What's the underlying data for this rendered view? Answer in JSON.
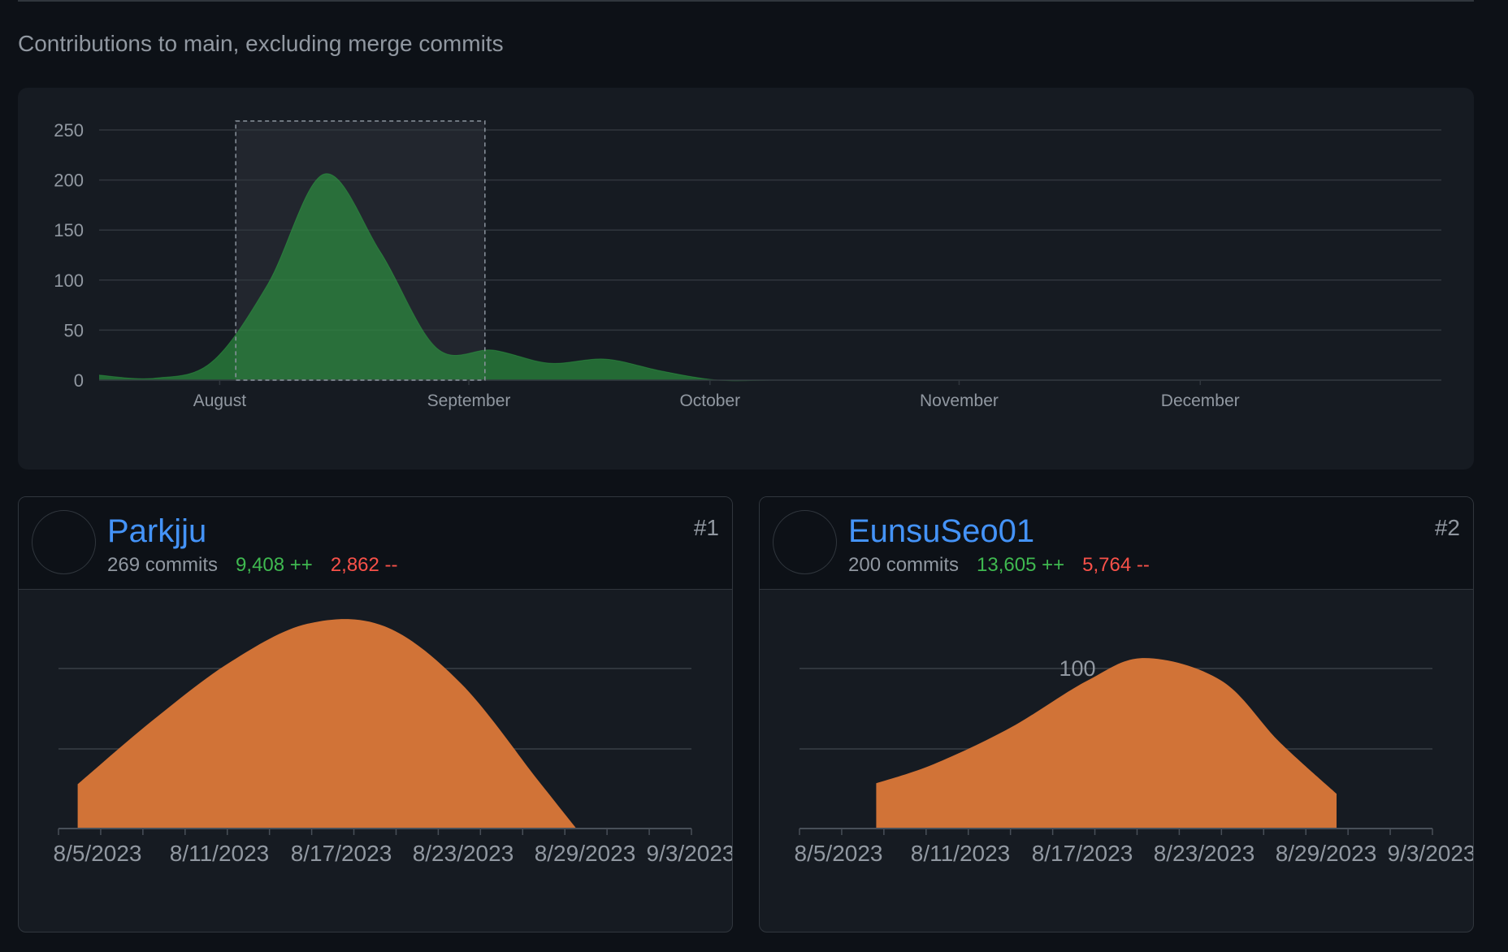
{
  "caption": "Contributions to main, excluding merge commits",
  "colors": {
    "background": "#0d1117",
    "panel": "#161b22",
    "border": "#30363d",
    "grid": "#30363d",
    "text_muted": "#9198a1",
    "link": "#4493f8",
    "additions": "#3fb950",
    "deletions": "#f85149",
    "main_area": "#2ea043",
    "contributor_area": "#d17337",
    "selection": "#30363d"
  },
  "chart_data": [
    {
      "type": "area",
      "title": "",
      "xlabel": "",
      "ylabel": "",
      "grid": true,
      "ylim": [
        0,
        250
      ],
      "y_ticks": [
        "0",
        "50",
        "100",
        "150",
        "200",
        "250"
      ],
      "x_range": [
        "2023-07-17",
        "2023-12-31"
      ],
      "x_ticks": [
        {
          "label": "August",
          "date": "2023-08-01"
        },
        {
          "label": "September",
          "date": "2023-09-01"
        },
        {
          "label": "October",
          "date": "2023-10-01"
        },
        {
          "label": "November",
          "date": "2023-11-01"
        },
        {
          "label": "December",
          "date": "2023-12-01"
        }
      ],
      "selection": {
        "start": "2023-08-03",
        "end": "2023-09-03"
      },
      "x": [
        "2023-07-17",
        "2023-07-24",
        "2023-07-31",
        "2023-08-07",
        "2023-08-14",
        "2023-08-21",
        "2023-08-28",
        "2023-09-04",
        "2023-09-11",
        "2023-09-18",
        "2023-09-25",
        "2023-10-02",
        "2023-10-09",
        "2023-10-16",
        "2023-10-23",
        "2023-10-30",
        "2023-11-06",
        "2023-11-13",
        "2023-11-20",
        "2023-11-27",
        "2023-12-04",
        "2023-12-11",
        "2023-12-18",
        "2023-12-25",
        "2023-12-31"
      ],
      "values": [
        5,
        2,
        18,
        96,
        206,
        128,
        32,
        30,
        17,
        21,
        9,
        0,
        0,
        0,
        0,
        0,
        0,
        0,
        0,
        0,
        0,
        0,
        0,
        0,
        0
      ]
    },
    {
      "type": "area",
      "title": "",
      "ylim": [
        0,
        160
      ],
      "grid": true,
      "x_range": [
        "2023-08-02",
        "2023-09-04"
      ],
      "x_ticks": [
        "8/5/2023",
        "8/11/2023",
        "8/17/2023",
        "8/23/2023",
        "8/29/2023",
        "9/3/2023"
      ],
      "x": [
        "2023-08-03",
        "2023-08-07",
        "2023-08-11",
        "2023-08-15",
        "2023-08-19",
        "2023-08-23",
        "2023-08-27",
        "2023-08-29"
      ],
      "values": [
        34,
        84,
        128,
        157,
        155,
        111,
        37,
        0
      ]
    },
    {
      "type": "area",
      "title": "",
      "ylim": [
        0,
        120
      ],
      "y_ticks": [
        "100"
      ],
      "grid": true,
      "x_range": [
        "2023-08-02",
        "2023-09-04"
      ],
      "x_ticks": [
        "8/5/2023",
        "8/11/2023",
        "8/17/2023",
        "8/23/2023",
        "8/29/2023",
        "9/3/2023"
      ],
      "x": [
        "2023-08-06",
        "2023-08-09",
        "2023-08-13",
        "2023-08-17",
        "2023-08-20",
        "2023-08-24",
        "2023-08-27",
        "2023-08-30"
      ],
      "values": [
        26,
        37,
        58,
        85,
        98,
        85,
        50,
        20
      ]
    }
  ],
  "contributors": [
    {
      "rank": "#1",
      "name": "Parkjju",
      "commits": "269 commits",
      "additions": "9,408 ++",
      "deletions": "2,862 --"
    },
    {
      "rank": "#2",
      "name": "EunsuSeo01",
      "commits": "200 commits",
      "additions": "13,605 ++",
      "deletions": "5,764 --"
    }
  ]
}
